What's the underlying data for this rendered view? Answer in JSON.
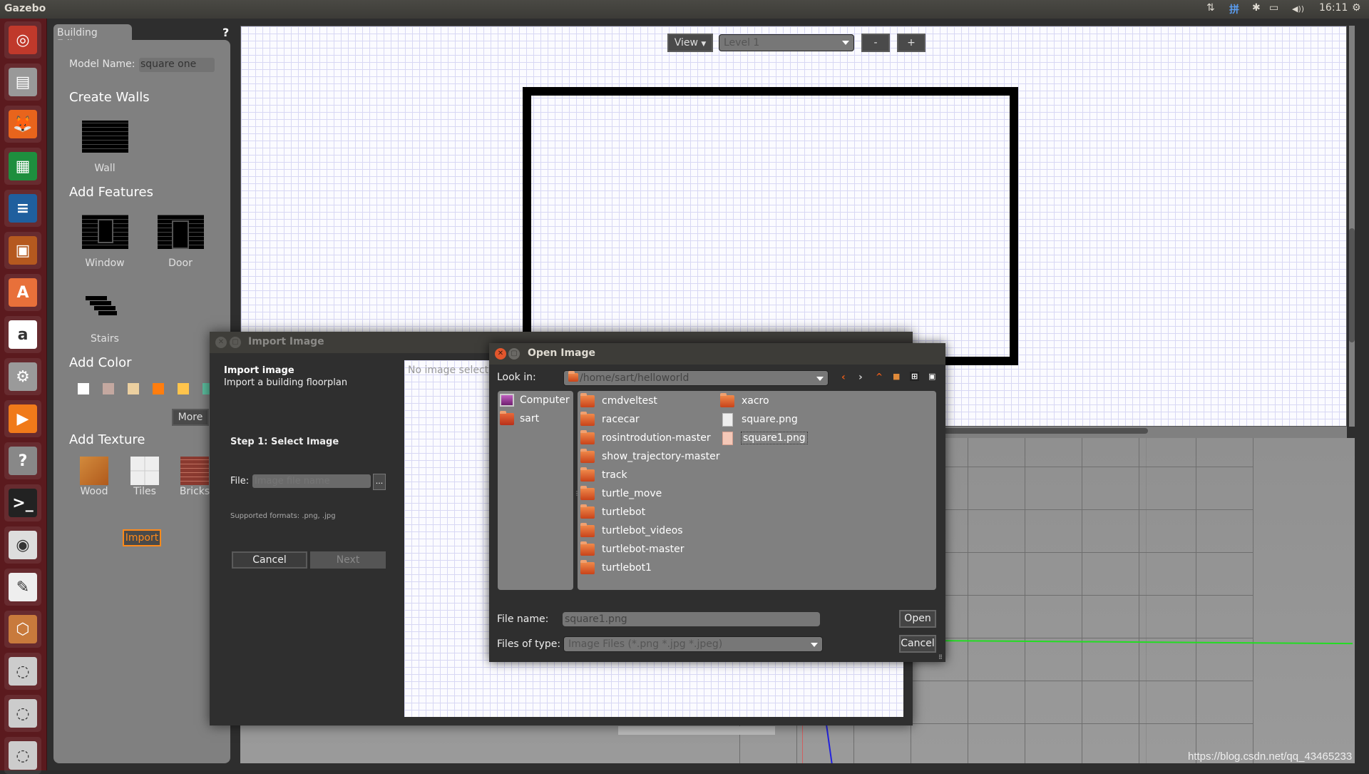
{
  "topbar": {
    "app_title": "Gazebo",
    "tray": {
      "network_icon": "⇅",
      "input_method": "拼",
      "bluetooth_icon": "✱",
      "battery_icon": "▭",
      "volume_icon": "◀))",
      "clock": "16:11",
      "power_icon": "⚙"
    }
  },
  "launcher": {
    "items": [
      {
        "name": "ubuntu-dash",
        "glyph": "◎",
        "color": "#c0392b"
      },
      {
        "name": "files",
        "glyph": "▤",
        "color": "#999999"
      },
      {
        "name": "firefox",
        "glyph": "🦊",
        "color": "#e8641c"
      },
      {
        "name": "libreoffice-calc",
        "glyph": "▦",
        "color": "#1e8e3e"
      },
      {
        "name": "libreoffice-writer",
        "glyph": "≡",
        "color": "#1f5f9e"
      },
      {
        "name": "libreoffice-impress",
        "glyph": "▣",
        "color": "#b5591f"
      },
      {
        "name": "software-center",
        "glyph": "A",
        "color": "#e8703a"
      },
      {
        "name": "amazon",
        "glyph": "a",
        "color": "#ffffff"
      },
      {
        "name": "system-settings",
        "glyph": "⚙",
        "color": "#9a9a9a"
      },
      {
        "name": "video-player",
        "glyph": "▶",
        "color": "#f07a1a"
      },
      {
        "name": "help",
        "glyph": "?",
        "color": "#888888"
      },
      {
        "name": "terminal",
        "glyph": ">_",
        "color": "#222222"
      },
      {
        "name": "eye-viewer",
        "glyph": "◉",
        "color": "#dddddd"
      },
      {
        "name": "text-editor",
        "glyph": "✎",
        "color": "#eeeeee"
      },
      {
        "name": "gazebo",
        "glyph": "⬡",
        "color": "#c87a3c"
      },
      {
        "name": "disk-1",
        "glyph": "◌",
        "color": "#cccccc"
      },
      {
        "name": "disk-2",
        "glyph": "◌",
        "color": "#cccccc"
      },
      {
        "name": "disk-3",
        "glyph": "◌",
        "color": "#cccccc"
      }
    ]
  },
  "editor": {
    "tab_label": "Building Editor",
    "help_label": "?",
    "model_name_label": "Model Name:",
    "model_name_value": "square one",
    "create_walls_header": "Create Walls",
    "wall_label": "Wall",
    "add_features_header": "Add Features",
    "window_label": "Window",
    "door_label": "Door",
    "stairs_label": "Stairs",
    "add_color_header": "Add Color",
    "colors": [
      "#ffffff",
      "#c4a8a0",
      "#ecd0a0",
      "#ff7d0e",
      "#ffc44c",
      "#5cc0a0"
    ],
    "more_label": "More",
    "add_texture_header": "Add Texture",
    "textures": [
      "Wood",
      "Tiles",
      "Bricks"
    ],
    "import_label": "Import"
  },
  "canvas_toolbar": {
    "view_label": "View",
    "level_value": "Level 1",
    "minus_label": "-",
    "plus_label": "+"
  },
  "import_dialog": {
    "title": "Import Image",
    "heading": "Import image",
    "subheading": "Import a building floorplan",
    "step_label": "Step 1: Select Image",
    "file_label": "File:",
    "file_placeholder": "Image file name",
    "browse_label": "...",
    "formats_note": "Supported formats: .png, .jpg",
    "cancel_label": "Cancel",
    "next_label": "Next",
    "preview_text": "No image selected"
  },
  "open_dialog": {
    "title": "Open Image",
    "look_in_label": "Look in:",
    "look_in_value": "/home/sart/helloworld",
    "sidebar": [
      {
        "label": "Computer",
        "icon": "computer"
      },
      {
        "label": "sart",
        "icon": "home-folder"
      }
    ],
    "files_col1": [
      "cmdveltest",
      "racecar",
      "rosintrodution-master",
      "show_trajectory-master",
      "track",
      "turtle_move",
      "turtlebot",
      "turtlebot_videos",
      "turtlebot-master",
      "turtlebot1"
    ],
    "files_col2": [
      {
        "label": "xacro",
        "type": "folder"
      },
      {
        "label": "square.png",
        "type": "file"
      },
      {
        "label": "square1.png",
        "type": "file-selected"
      }
    ],
    "file_name_label": "File name:",
    "file_name_value": "square1.png",
    "files_of_type_label": "Files of type:",
    "files_of_type_value": "Image Files (*.png *.jpg *.jpeg)",
    "open_label": "Open",
    "cancel_label": "Cancel"
  },
  "watermark": "https://blog.csdn.net/qq_43465233"
}
